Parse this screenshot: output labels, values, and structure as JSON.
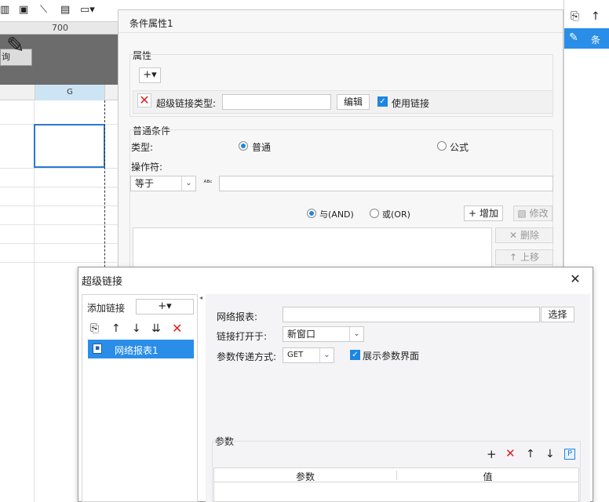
{
  "designer": {
    "ruler_label": "700",
    "query_button_label": "询",
    "column_label": "G"
  },
  "right_panel": {
    "selected_item_label": "条件"
  },
  "condition_dialog": {
    "title": "条件属性1",
    "attributes_section_label": "属性",
    "add_label": "+▾",
    "hyperlink_type_label": "超级链接类型:",
    "hyperlink_type_value": "",
    "edit_button_label": "编辑",
    "use_link_label": "使用链接",
    "use_link_checked": true,
    "normal_condition_label": "普通条件",
    "type_label": "类型:",
    "type_option_normal": "普通",
    "type_option_formula": "公式",
    "type_selected": "普通",
    "operator_label": "操作符:",
    "operator_value": "等于",
    "operand_value": "",
    "logic_and_label": "与(AND)",
    "logic_or_label": "或(OR)",
    "logic_selected": "与(AND)",
    "add_button_label": "增加",
    "modify_button_label": "修改",
    "delete_button_label": "删除",
    "move_up_button_label": "上移"
  },
  "hyperlink_dialog": {
    "title": "超级链接",
    "add_link_label": "添加链接",
    "add_dropdown_label": "+▾",
    "tree_items": [
      "网络报表1"
    ],
    "web_report_label": "网络报表:",
    "web_report_value": "",
    "select_button_label": "选择",
    "open_in_label": "链接打开于:",
    "open_in_value": "新窗口",
    "param_method_label": "参数传递方式:",
    "param_method_value": "GET",
    "show_param_label": "展示参数界面",
    "show_param_checked": true,
    "params_section_label": "参数",
    "params_columns": [
      "参数",
      "值"
    ]
  },
  "colors": {
    "accent": "#1e86e0",
    "selection": "#2a8ee8",
    "delete_red": "#e02020"
  }
}
